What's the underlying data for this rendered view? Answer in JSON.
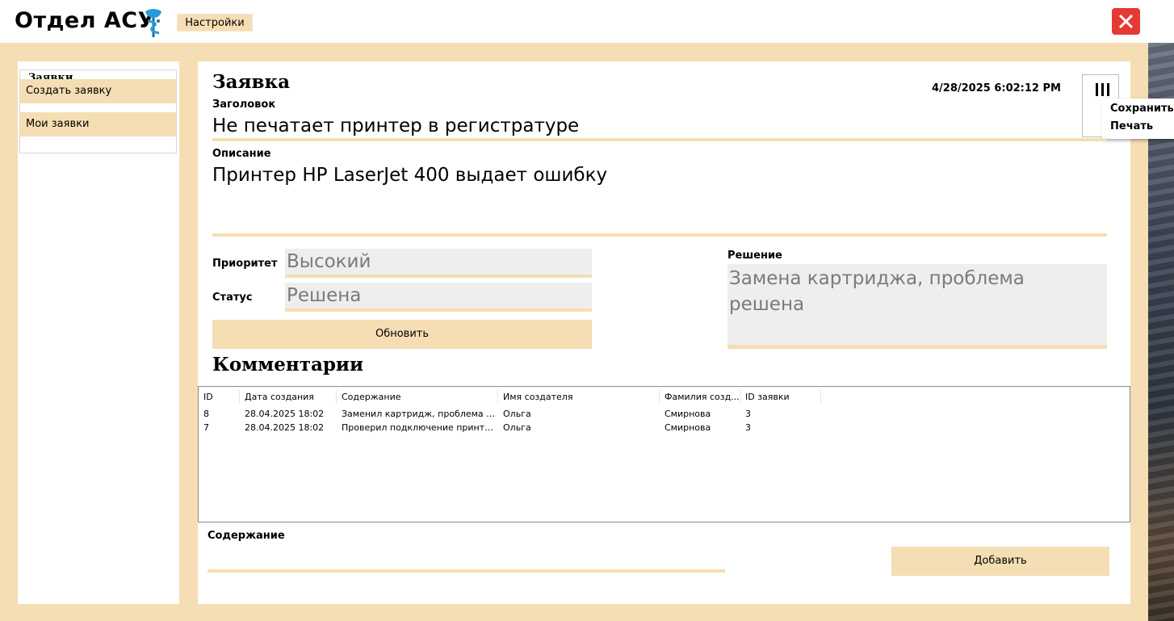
{
  "app": {
    "title": "Отдел АСУ",
    "logo_icon": "caduceus-bowl-icon",
    "settings_label": "Настройки",
    "close_icon": "close-icon"
  },
  "sidebar": {
    "group_title": "Заявки",
    "items": [
      {
        "label": "Создать заявку"
      },
      {
        "label": "Мои заявки"
      }
    ]
  },
  "ticket": {
    "heading": "Заявка",
    "datetime": "4/28/2025 6:02:12 PM",
    "menu_icon": "menu-bars-icon",
    "menu": {
      "save_label": "Сохранить",
      "print_label": "Печать"
    },
    "title_label": "Заголовок",
    "title_value": "Не печатает принтер в регистратуре",
    "description_label": "Описание",
    "description_value": "Принтер HP LaserJet 400 выдает ошибку",
    "priority_label": "Приоритет",
    "priority_value": "Высокий",
    "status_label": "Статус",
    "status_value": "Решена",
    "update_label": "Обновить",
    "solution_label": "Решение",
    "solution_value": "Замена картриджа, проблема решена"
  },
  "comments": {
    "heading": "Комментарии",
    "columns": [
      "ID",
      "Дата создания",
      "Содержание",
      "Имя создателя",
      "Фамилия созд...",
      "ID заявки"
    ],
    "rows": [
      [
        "8",
        "28.04.2025 18:02",
        "Заменил картридж, проблема реш...",
        "Ольга",
        "Смирнова",
        "3"
      ],
      [
        "7",
        "28.04.2025 18:02",
        "Проверил подключение принтера -...",
        "Ольга",
        "Смирнова",
        "3"
      ]
    ],
    "content_label": "Содержание",
    "content_value": "",
    "add_label": "Добавить"
  },
  "colors": {
    "accent": "#f5deb3",
    "close": "#e53935",
    "field_bg": "#eeeeee",
    "field_text": "#7a7a7a"
  }
}
